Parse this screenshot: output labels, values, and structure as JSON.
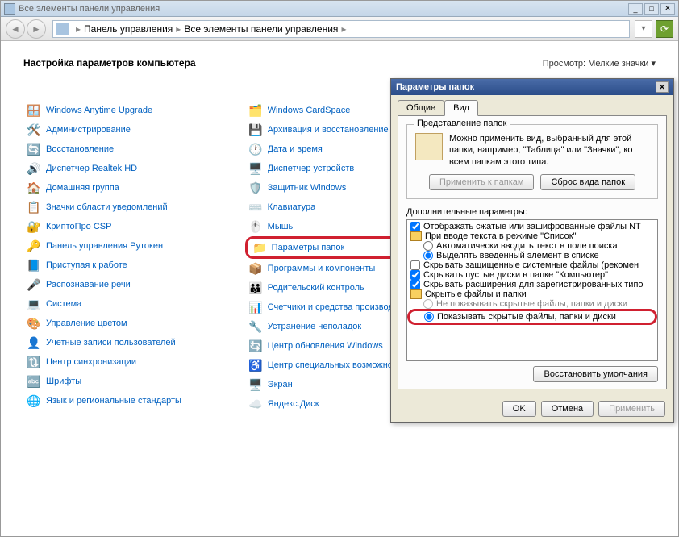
{
  "window": {
    "title": "Все элементы панели управления"
  },
  "breadcrumb": {
    "item1": "Панель управления",
    "item2": "Все элементы панели управления"
  },
  "page": {
    "title": "Настройка параметров компьютера",
    "view_label": "Просмотр:",
    "view_value": "Мелкие значки"
  },
  "items_col1": [
    {
      "icon": "🪟",
      "label": "Windows Anytime Upgrade"
    },
    {
      "icon": "🛠️",
      "label": "Администрирование"
    },
    {
      "icon": "🔄",
      "label": "Восстановление"
    },
    {
      "icon": "🔊",
      "label": "Диспетчер Realtek HD"
    },
    {
      "icon": "🏠",
      "label": "Домашняя группа"
    },
    {
      "icon": "📋",
      "label": "Значки области уведомлений"
    },
    {
      "icon": "🔐",
      "label": "КриптоПро CSP"
    },
    {
      "icon": "🔑",
      "label": "Панель управления Рутокен"
    },
    {
      "icon": "📘",
      "label": "Приступая к работе"
    },
    {
      "icon": "🎤",
      "label": "Распознавание речи"
    },
    {
      "icon": "💻",
      "label": "Система"
    },
    {
      "icon": "🎨",
      "label": "Управление цветом"
    },
    {
      "icon": "👤",
      "label": "Учетные записи пользователей"
    },
    {
      "icon": "🔃",
      "label": "Центр синхронизации"
    },
    {
      "icon": "🔤",
      "label": "Шрифты"
    },
    {
      "icon": "🌐",
      "label": "Язык и региональные стандарты"
    }
  ],
  "items_col2": [
    {
      "icon": "🗂️",
      "label": "Windows CardSpace"
    },
    {
      "icon": "💾",
      "label": "Архивация и восстановление"
    },
    {
      "icon": "🕐",
      "label": "Дата и время"
    },
    {
      "icon": "🖥️",
      "label": "Диспетчер устройств"
    },
    {
      "icon": "🛡️",
      "label": "Защитник Windows"
    },
    {
      "icon": "⌨️",
      "label": "Клавиатура"
    },
    {
      "icon": "🖱️",
      "label": "Мышь"
    },
    {
      "icon": "📁",
      "label": "Параметры папок",
      "highlight": true
    },
    {
      "icon": "📦",
      "label": "Программы и компоненты"
    },
    {
      "icon": "👪",
      "label": "Родительский контроль"
    },
    {
      "icon": "📊",
      "label": "Счетчики и средства производите"
    },
    {
      "icon": "🔧",
      "label": "Устранение неполадок"
    },
    {
      "icon": "🔄",
      "label": "Центр обновления Windows"
    },
    {
      "icon": "♿",
      "label": "Центр специальных возможностей"
    },
    {
      "icon": "🖥️",
      "label": "Экран"
    },
    {
      "icon": "☁️",
      "label": "Яндекс.Диск"
    }
  ],
  "dialog": {
    "title": "Параметры папок",
    "tabs": {
      "general": "Общие",
      "view": "Вид"
    },
    "group_title": "Представление папок",
    "group_text": "Можно применить вид, выбранный для этой папки, например, \"Таблица\" или \"Значки\", ко всем папкам этого типа.",
    "btn_apply_folders": "Применить к папкам",
    "btn_reset_folders": "Сброс вида папок",
    "adv_label": "Дополнительные параметры:",
    "tree": [
      {
        "type": "chk",
        "checked": true,
        "indent": 0,
        "label": "Отображать сжатые или зашифрованные файлы NT"
      },
      {
        "type": "folder",
        "indent": 0,
        "label": "При вводе текста в режиме \"Список\""
      },
      {
        "type": "rad",
        "checked": false,
        "indent": 1,
        "label": "Автоматически вводить текст в поле поиска"
      },
      {
        "type": "rad",
        "checked": true,
        "indent": 1,
        "label": "Выделять введенный элемент в списке"
      },
      {
        "type": "chk",
        "checked": false,
        "indent": 0,
        "label": "Скрывать защищенные системные файлы (рекомен"
      },
      {
        "type": "chk",
        "checked": true,
        "indent": 0,
        "label": "Скрывать пустые диски в папке \"Компьютер\""
      },
      {
        "type": "chk",
        "checked": true,
        "indent": 0,
        "label": "Скрывать расширения для зарегистрированных типо"
      },
      {
        "type": "folder",
        "indent": 0,
        "label": "Скрытые файлы и папки"
      },
      {
        "type": "rad",
        "checked": false,
        "indent": 1,
        "label": "Не показывать скрытые файлы, папки и диски",
        "dim": true
      },
      {
        "type": "rad",
        "checked": true,
        "indent": 1,
        "label": "Показывать скрытые файлы, папки и диски",
        "highlight": true
      }
    ],
    "btn_restore": "Восстановить умолчания",
    "btn_ok": "OK",
    "btn_cancel": "Отмена",
    "btn_apply": "Применить"
  }
}
